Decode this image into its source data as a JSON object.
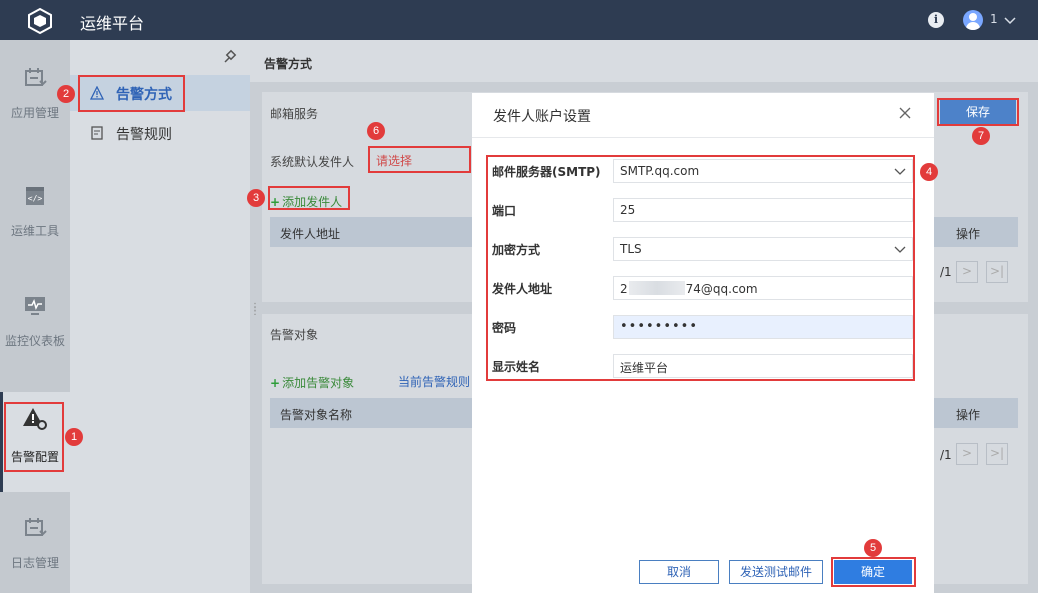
{
  "app": {
    "title": "运维平台",
    "user": "1"
  },
  "rail": [
    {
      "label": "应用管理",
      "icon": "app-manage-icon"
    },
    {
      "label": "运维工具",
      "icon": "code-tool-icon"
    },
    {
      "label": "监控仪表板",
      "icon": "monitor-icon"
    },
    {
      "label": "告警配置",
      "icon": "alert-config-icon"
    },
    {
      "label": "日志管理",
      "icon": "log-manage-icon"
    }
  ],
  "submenu": [
    {
      "label": "告警方式",
      "icon": "warning-icon"
    },
    {
      "label": "告警规则",
      "icon": "rule-icon"
    }
  ],
  "content": {
    "title": "告警方式",
    "mail": {
      "section_label": "邮箱服务",
      "default_sender_label": "系统默认发件人",
      "default_sender_placeholder": "请选择",
      "add_sender": "添加发件人",
      "col_address": "发件人地址",
      "col_action": "操作",
      "page_text": "/1",
      "save": "保存"
    },
    "target": {
      "section_label": "告警对象",
      "add_target": "添加告警对象",
      "current_rule": "当前告警规则",
      "col_name": "告警对象名称",
      "col_action": "操作",
      "page_text": "/1"
    }
  },
  "modal": {
    "title": "发件人账户设置",
    "fields": [
      {
        "label": "邮件服务器(SMTP)",
        "value": "SMTP.qq.com",
        "type": "select"
      },
      {
        "label": "端口",
        "value": "25",
        "type": "text"
      },
      {
        "label": "加密方式",
        "value": "TLS",
        "type": "select"
      },
      {
        "label": "发件人地址",
        "value_prefix": "2",
        "value_suffix": "74@qq.com",
        "type": "text"
      },
      {
        "label": "密码",
        "value": "•••••••••",
        "type": "password"
      },
      {
        "label": "显示姓名",
        "value": "运维平台",
        "type": "text"
      }
    ],
    "buttons": {
      "cancel": "取消",
      "test": "发送测试邮件",
      "ok": "确定"
    }
  },
  "annotations": [
    "1",
    "2",
    "3",
    "4",
    "5",
    "6",
    "7"
  ],
  "colors": {
    "topbar": "#2e3c52",
    "accent": "#2f7de1",
    "annotation_red": "#e23b3b"
  }
}
